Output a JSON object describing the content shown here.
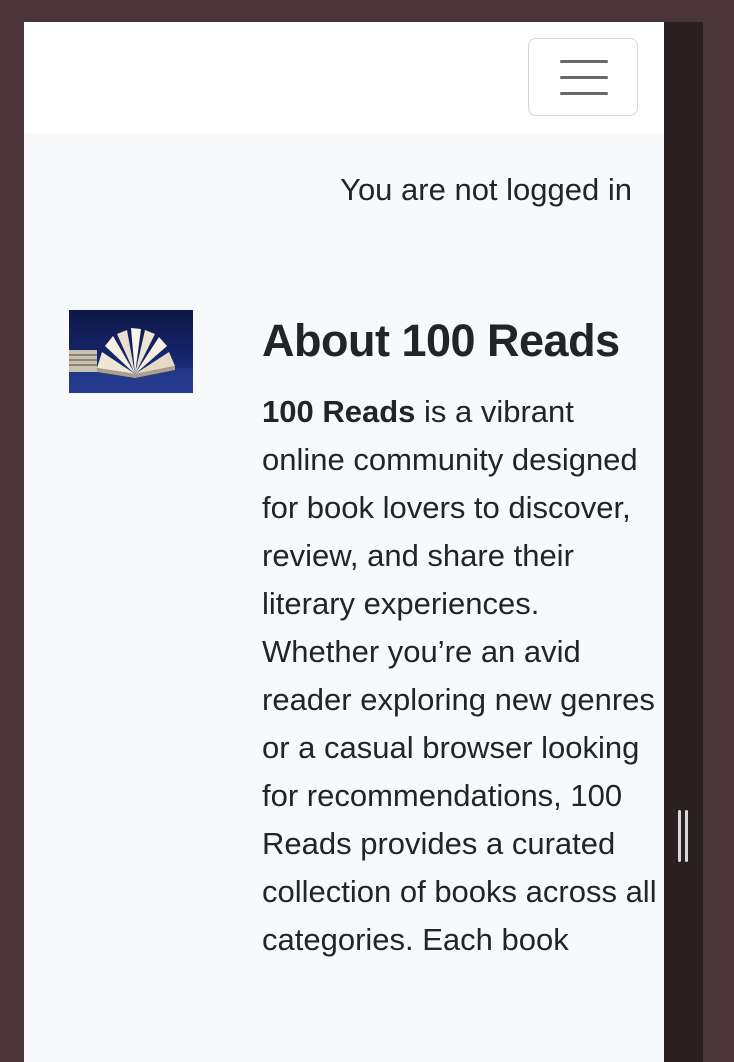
{
  "header": {
    "menu_icon": "hamburger-menu-icon"
  },
  "status": {
    "login_text": "You are not logged in"
  },
  "about": {
    "image_alt": "open book",
    "title": "About 100 Reads",
    "brand": "100 Reads",
    "body": " is a vibrant online community designed for book lovers to discover, review, and share their literary experiences. Whether you’re an avid reader exploring new genres or a casual browser looking for recommendations, 100 Reads provides a curated collection of books across all categories. Each book"
  },
  "colors": {
    "window_frame": "#4c343b",
    "page_background": "#f8f9fa",
    "navbar_background": "#ffffff",
    "text": "#212529"
  }
}
